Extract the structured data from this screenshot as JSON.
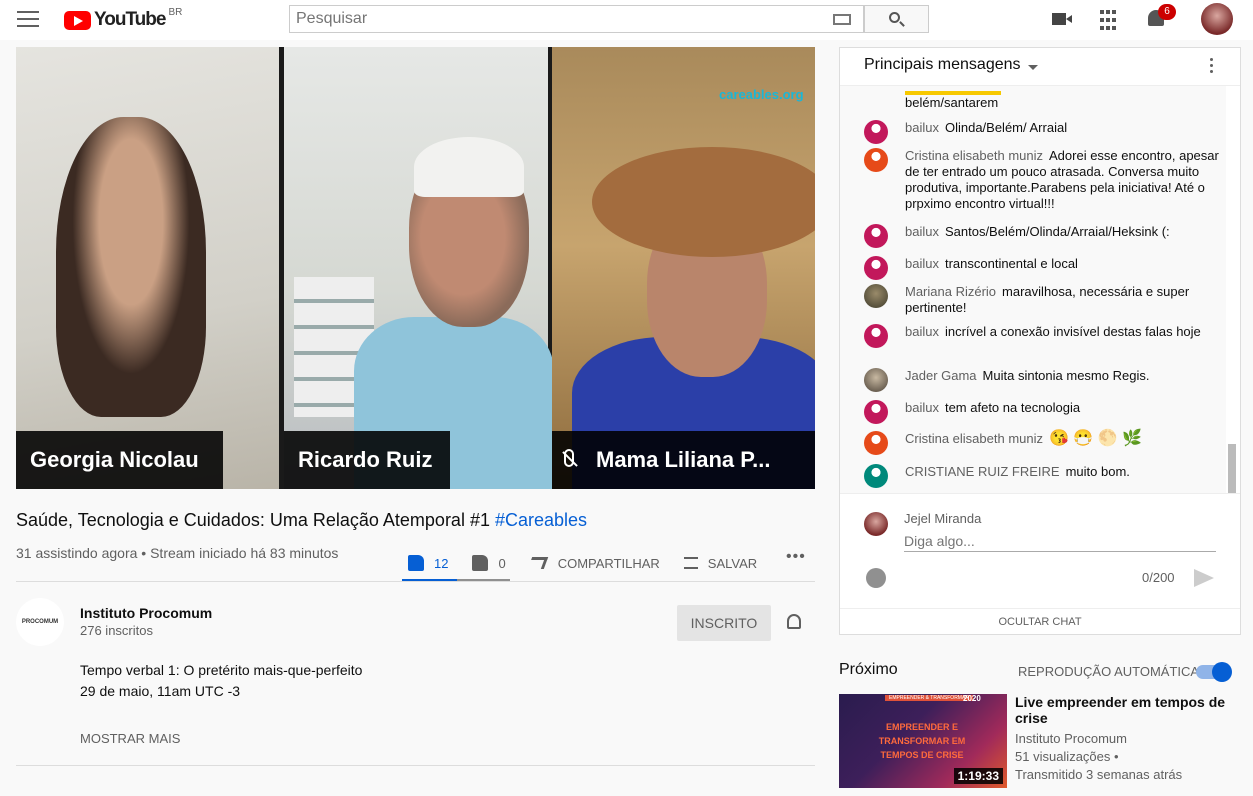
{
  "header": {
    "logo_text": "YouTube",
    "country": "BR",
    "search_placeholder": "Pesquisar",
    "notifications_count": "6"
  },
  "video": {
    "watermark": "careables.org",
    "participants": [
      "Georgia Nicolau",
      "Ricardo Ruiz",
      "Mama Liliana P..."
    ],
    "title": "Saúde, Tecnologia e Cuidados: Uma Relação Atemporal #1",
    "hashtag": "#Careables",
    "meta": "31 assistindo agora • Stream iniciado há 83 minutos",
    "likes": "12",
    "dislikes": "0",
    "share_label": "COMPARTILHAR",
    "save_label": "SALVAR",
    "more_label": "•••"
  },
  "channel": {
    "logo_text": "PROCOMUM",
    "name": "Instituto Procomum",
    "subscribers": "276 inscritos",
    "subscribe_label": "INSCRITO",
    "description_line1": "Tempo verbal 1: O pretérito mais-que-perfeito",
    "description_line2": "29 de maio, 11am UTC -3",
    "show_more": "MOSTRAR MAIS"
  },
  "chat": {
    "title": "Principais mensagens",
    "first_line": "belém/santarem",
    "messages": [
      {
        "author": "bailux",
        "text": "Olinda/Belém/ Arraial"
      },
      {
        "author": "Cristina elisabeth muniz",
        "text": "Adorei esse encontro, apesar de ter entrado um pouco atrasada. Conversa muito produtiva, importante.Parabens pela iniciativa! Até o prpximo encontro virtual!!!"
      },
      {
        "author": "bailux",
        "text": "Santos/Belém/Olinda/Arraial/Heksink (:"
      },
      {
        "author": "bailux",
        "text": "transcontinental e local"
      },
      {
        "author": "Mariana Rizério",
        "text": "maravilhosa, necessária e super pertinente!"
      },
      {
        "author": "bailux",
        "text": "incrível a conexão invisível destas falas hoje"
      },
      {
        "author": "Jader Gama",
        "text": "Muita sintonia mesmo Regis."
      },
      {
        "author": "bailux",
        "text": "tem afeto na tecnologia"
      },
      {
        "author": "Cristina elisabeth muniz",
        "text": "😘 😷 🌕 🌿"
      },
      {
        "author": "CRISTIANE RUIZ FREIRE",
        "text": "muito bom."
      }
    ],
    "user_name": "Jejel Miranda",
    "input_placeholder": "Diga algo...",
    "counter": "0/200",
    "hide_label": "OCULTAR CHAT"
  },
  "upnext": {
    "title": "Próximo",
    "autoplay_label": "REPRODUÇÃO AUTOMÁTICA",
    "autoplay_on": true,
    "thumb_banner": "EMPREENDER & TRANSFORMAR",
    "thumb_year": "2020",
    "thumb_text": "EMPREENDER E TRANSFORMAR EM TEMPOS DE CRISE",
    "duration": "1:19:33",
    "video_title": "Live empreender em tempos de crise",
    "channel": "Instituto Procomum",
    "views": "51 visualizações •",
    "ago": "Transmitido 3 semanas atrás"
  },
  "colors": {
    "accent": "#065fd4",
    "brand_red": "#ff0000"
  }
}
